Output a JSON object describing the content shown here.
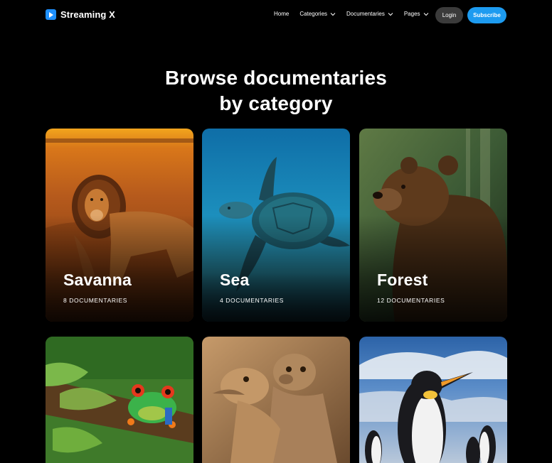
{
  "brand": {
    "name": "Streaming X",
    "logo_icon": "play-icon",
    "accent": "#1d9bf0"
  },
  "nav": {
    "items": [
      {
        "label": "Home",
        "has_dropdown": false
      },
      {
        "label": "Categories",
        "has_dropdown": true
      },
      {
        "label": "Documentaries",
        "has_dropdown": true
      },
      {
        "label": "Pages",
        "has_dropdown": true
      }
    ],
    "login_label": "Login",
    "subscribe_label": "Subscribe"
  },
  "hero": {
    "title_line1": "Browse documentaries",
    "title_line2": "by category"
  },
  "categories": [
    {
      "name": "Savanna",
      "count": "8 Documentaries",
      "image": "lion"
    },
    {
      "name": "Sea",
      "count": "4 Documentaries",
      "image": "sea-turtle"
    },
    {
      "name": "Forest",
      "count": "12 Documentaries",
      "image": "brown-bear"
    },
    {
      "name": "",
      "count": "",
      "image": "tree-frog"
    },
    {
      "name": "",
      "count": "",
      "image": "meerkats"
    },
    {
      "name": "",
      "count": "",
      "image": "penguins"
    }
  ]
}
